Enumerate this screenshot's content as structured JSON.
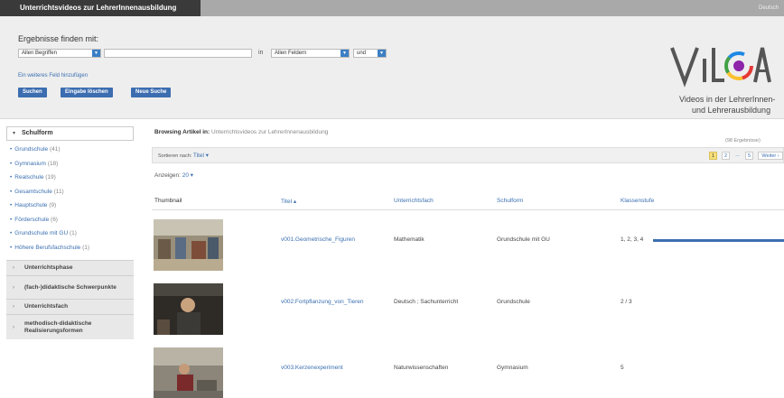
{
  "header": {
    "title": "Unterrichtsvideos zur LehrerInnenausbildung",
    "language": "Deutsch"
  },
  "search": {
    "heading": "Ergebnisse finden mit:",
    "term_type": "Allen Begriffen",
    "term_value": "",
    "in_label": "in",
    "field": "Allen Feldern",
    "operator": "und",
    "add_field": "Ein weiteres Feld hinzufügen",
    "buttons": {
      "search": "Suchen",
      "clear": "Eingabe löschen",
      "new": "Neue Suche"
    }
  },
  "logo": {
    "tagline1": "Videos in der LehrerInnen-",
    "tagline2": "und Lehrerausbildung",
    "colors": {
      "ring": [
        "#e53935",
        "#fbc02d",
        "#43a047",
        "#1e88e5",
        "#8e24aa"
      ],
      "text": "#555555"
    }
  },
  "sidebar": {
    "open_facet": "Schulform",
    "items": [
      {
        "label": "Grundschule",
        "count": "(41)"
      },
      {
        "label": "Gymnasium",
        "count": "(18)"
      },
      {
        "label": "Realschule",
        "count": "(19)"
      },
      {
        "label": "Gesamtschule",
        "count": "(11)"
      },
      {
        "label": "Hauptschule",
        "count": "(9)"
      },
      {
        "label": "Förderschule",
        "count": "(6)"
      },
      {
        "label": "Grundschule mit GU",
        "count": "(1)"
      },
      {
        "label": "Höhere Berufsfachschule",
        "count": "(1)"
      }
    ],
    "collapsed": [
      "Unterrichtsphase",
      "(fach-)didaktische Schwerpunkte",
      "Unterrichtsfach",
      "methodisch-didaktische Realisierungsformen"
    ]
  },
  "main": {
    "browse_label": "Browsing Artikel in:",
    "browse_collection": "Unterrichtsvideos zur LehrerInnenausbildung",
    "results_count": "(98 Ergebnisse)",
    "sort_label": "Sortieren nach:",
    "sort_value": "Titel ▾",
    "pages": [
      "1",
      "2",
      "...",
      "5"
    ],
    "next_label": "Weiter ›",
    "show_label": "Anzeigen:",
    "show_value": "20 ▾",
    "columns": [
      "Thumbnail",
      "Titel ▴",
      "Unterrichtsfach",
      "Schulform",
      "Klassenstufe"
    ],
    "rows": [
      {
        "title": "v001.Geometrische_Figuren",
        "subject": "Mathematik",
        "school": "Grundschule mit GU",
        "grade": "1, 2, 3, 4"
      },
      {
        "title": "v002.Fortpflanzung_von_Tieren",
        "subject": "Deutsch ; Sachunterricht",
        "school": "Grundschule",
        "grade": "2 / 3"
      },
      {
        "title": "v003.Kerzenexperiment",
        "subject": "Naturwissenschaften",
        "school": "Gymnasium",
        "grade": "5"
      }
    ]
  }
}
